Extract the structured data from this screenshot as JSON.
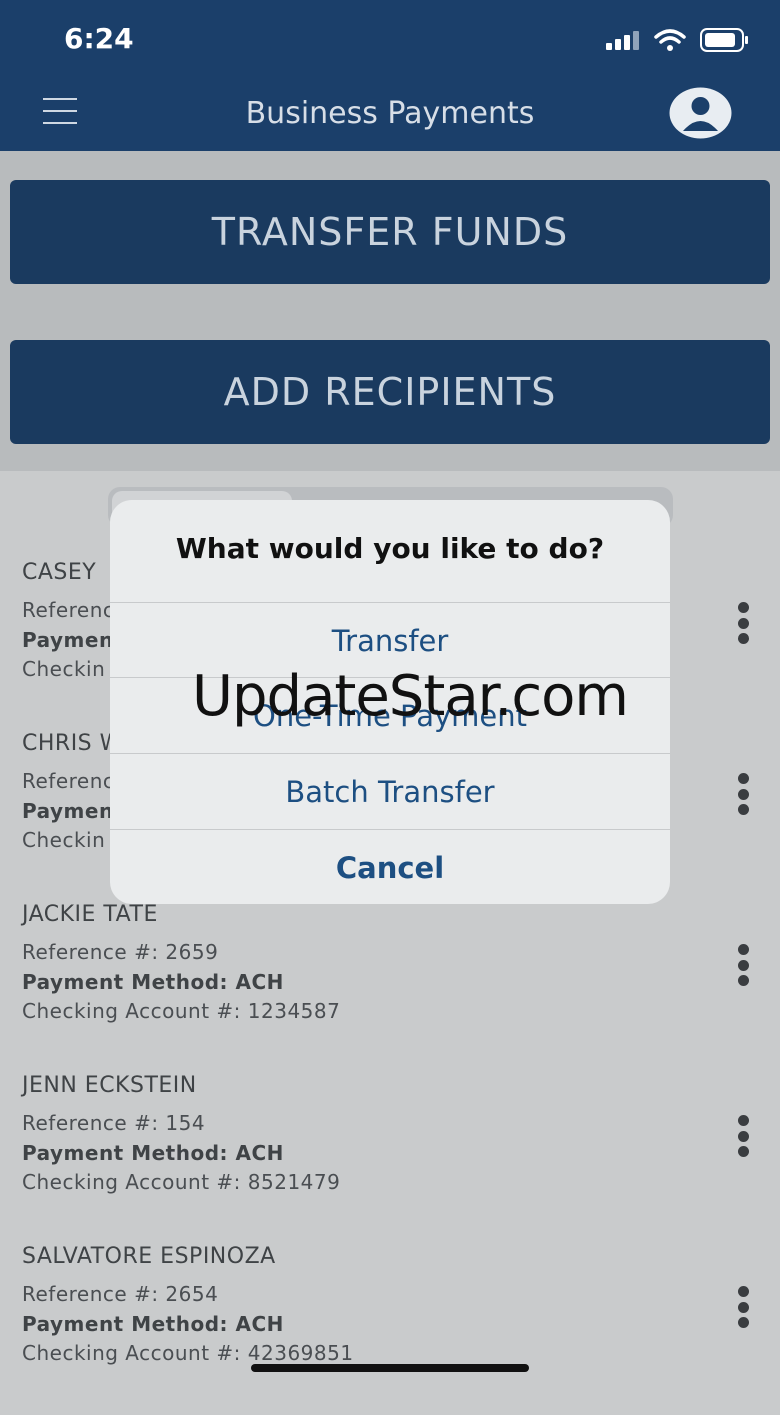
{
  "status": {
    "time": "6:24"
  },
  "nav": {
    "title": "Business Payments"
  },
  "buttons": {
    "transfer": "TRANSFER FUNDS",
    "add": "ADD RECIPIENTS"
  },
  "recipients": [
    {
      "name": "CASEY",
      "ref": "Referenc",
      "method": "Paymen",
      "account": "Checkin"
    },
    {
      "name": "CHRIS W",
      "ref": "Referenc",
      "method": "Paymen",
      "account": "Checkin"
    },
    {
      "name": "JACKIE TATE",
      "ref": "Reference #: 2659",
      "method": "Payment Method: ACH",
      "account": "Checking Account #: 1234587"
    },
    {
      "name": "JENN ECKSTEIN",
      "ref": "Reference #: 154",
      "method": "Payment Method: ACH",
      "account": "Checking Account #: 8521479"
    },
    {
      "name": "SALVATORE ESPINOZA",
      "ref": "Reference #: 2654",
      "method": "Payment Method: ACH",
      "account": "Checking Account #: 42369851"
    }
  ],
  "dialog": {
    "title": "What would you like to do?",
    "options": [
      "Transfer",
      "One-Time Payment",
      "Batch Transfer"
    ],
    "cancel": "Cancel"
  },
  "watermark": "UpdateStar.com",
  "colors": {
    "navy": "#1b3f6a",
    "accent": "#1d4f82"
  }
}
